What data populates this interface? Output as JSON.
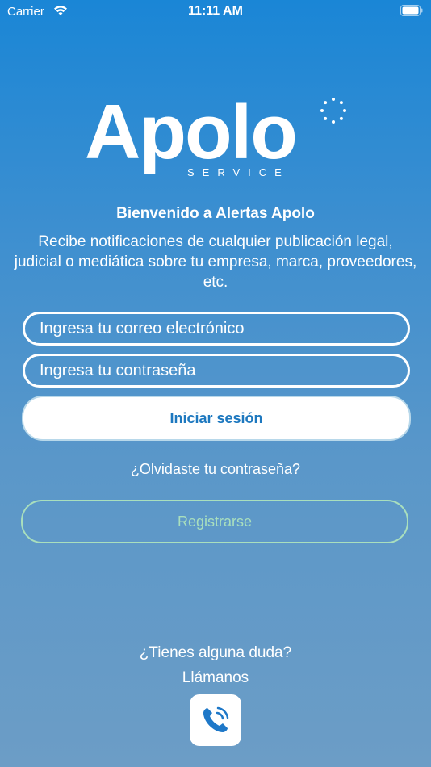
{
  "status_bar": {
    "carrier": "Carrier",
    "time": "11:11 AM"
  },
  "logo": {
    "wordmark": "Apolo",
    "subtitle": "SERVICE"
  },
  "welcome_title": "Bienvenido a Alertas Apolo",
  "description": "Recibe notificaciones de cualquier publicación legal, judicial o mediática sobre tu empresa, marca, proveedores, etc.",
  "login_form": {
    "email_placeholder": "Ingresa tu correo electrónico",
    "password_placeholder": "Ingresa tu contraseña",
    "login_label": "Iniciar sesión",
    "forgot_password_label": "¿Olvidaste tu contraseña?",
    "register_label": "Registrarse"
  },
  "help": {
    "question": "¿Tienes alguna duda?",
    "call_label": "Llámanos",
    "call_icon": "phone-call-icon"
  },
  "colors": {
    "background_top": "#1a86d6",
    "background_bottom": "#6c9dc6",
    "login_text": "#1d78bf",
    "register_accent": "#a9dfbd",
    "phone_icon": "#1e78c8"
  }
}
